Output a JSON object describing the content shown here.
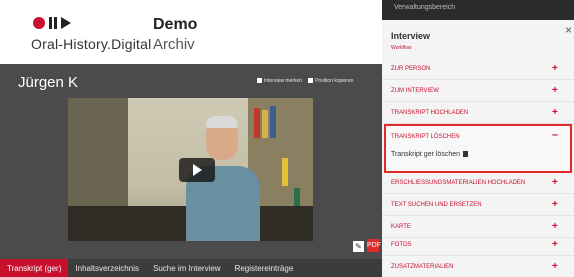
{
  "header": {
    "logo_text": "Oral-History.Digital",
    "title": "Demo",
    "subtitle": "Archiv"
  },
  "interview": {
    "title": "Jürgen K",
    "mark_label": "Interview merken",
    "bookmark_label": "Position kopieren",
    "pdf_label": "PDF"
  },
  "tabs": [
    {
      "label": "Transkript (ger)",
      "active": true
    },
    {
      "label": "Inhaltsverzeichnis",
      "active": false
    },
    {
      "label": "Suche im Interview",
      "active": false
    },
    {
      "label": "Registereinträge",
      "active": false
    }
  ],
  "sidebar": {
    "top_label": "Verwaltungsbereich",
    "heading": "Interview",
    "sub": "Workflow",
    "close": "×",
    "items": [
      {
        "label": "ZUR PERSON"
      },
      {
        "label": "ZUM INTERVIEW"
      },
      {
        "label": "TRANSKRIPT HOCHLADEN"
      }
    ],
    "open_item": {
      "label": "TRANSKRIPT LÖSCHEN",
      "action": "Transkript ger löschen"
    },
    "items_after": [
      {
        "label": "ERSCHLIESSUNGSMATERIALIEN HOCHLADEN"
      },
      {
        "label": "TEXT SUCHEN UND ERSETZEN"
      },
      {
        "label": "KARTE"
      },
      {
        "label": "FOTOS"
      },
      {
        "label": "ZUSATZMATERIALIEN"
      }
    ]
  },
  "colors": {
    "accent": "#c8102e",
    "dark": "#4b4b4b",
    "tabbar": "#3c3c3c",
    "highlight_border": "#e02b2b"
  }
}
